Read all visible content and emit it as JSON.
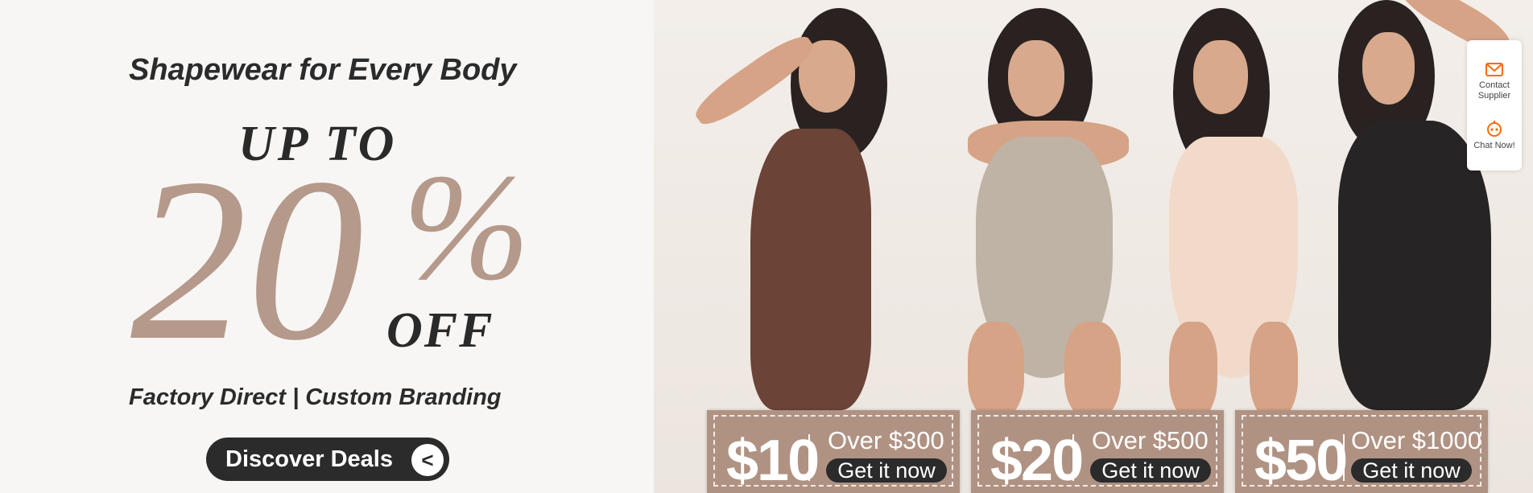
{
  "promo": {
    "tagline": "Shapewear for Every Body",
    "up_to": "UP TO",
    "percent_value": "20",
    "percent_sign": "%",
    "off": "OFF",
    "subline": "Factory Direct | Custom Branding",
    "cta_label": "Discover Deals",
    "cta_arrow": "<"
  },
  "coupons": [
    {
      "amount": "$10",
      "condition": "Over $300",
      "button": "Get it now"
    },
    {
      "amount": "$20",
      "condition": "Over $500",
      "button": "Get it now"
    },
    {
      "amount": "$50",
      "condition": "Over $1000",
      "button": "Get it now"
    }
  ],
  "sidebar": {
    "contact_icon": "mail-icon",
    "contact_label": "Contact Supplier",
    "chat_icon": "chat-bot-icon",
    "chat_label": "Chat Now!",
    "accent": "#ff6a00"
  },
  "colors": {
    "accent_beige": "#b5998a",
    "dark": "#2b2b2b",
    "coupon_bg": "#b09283"
  }
}
